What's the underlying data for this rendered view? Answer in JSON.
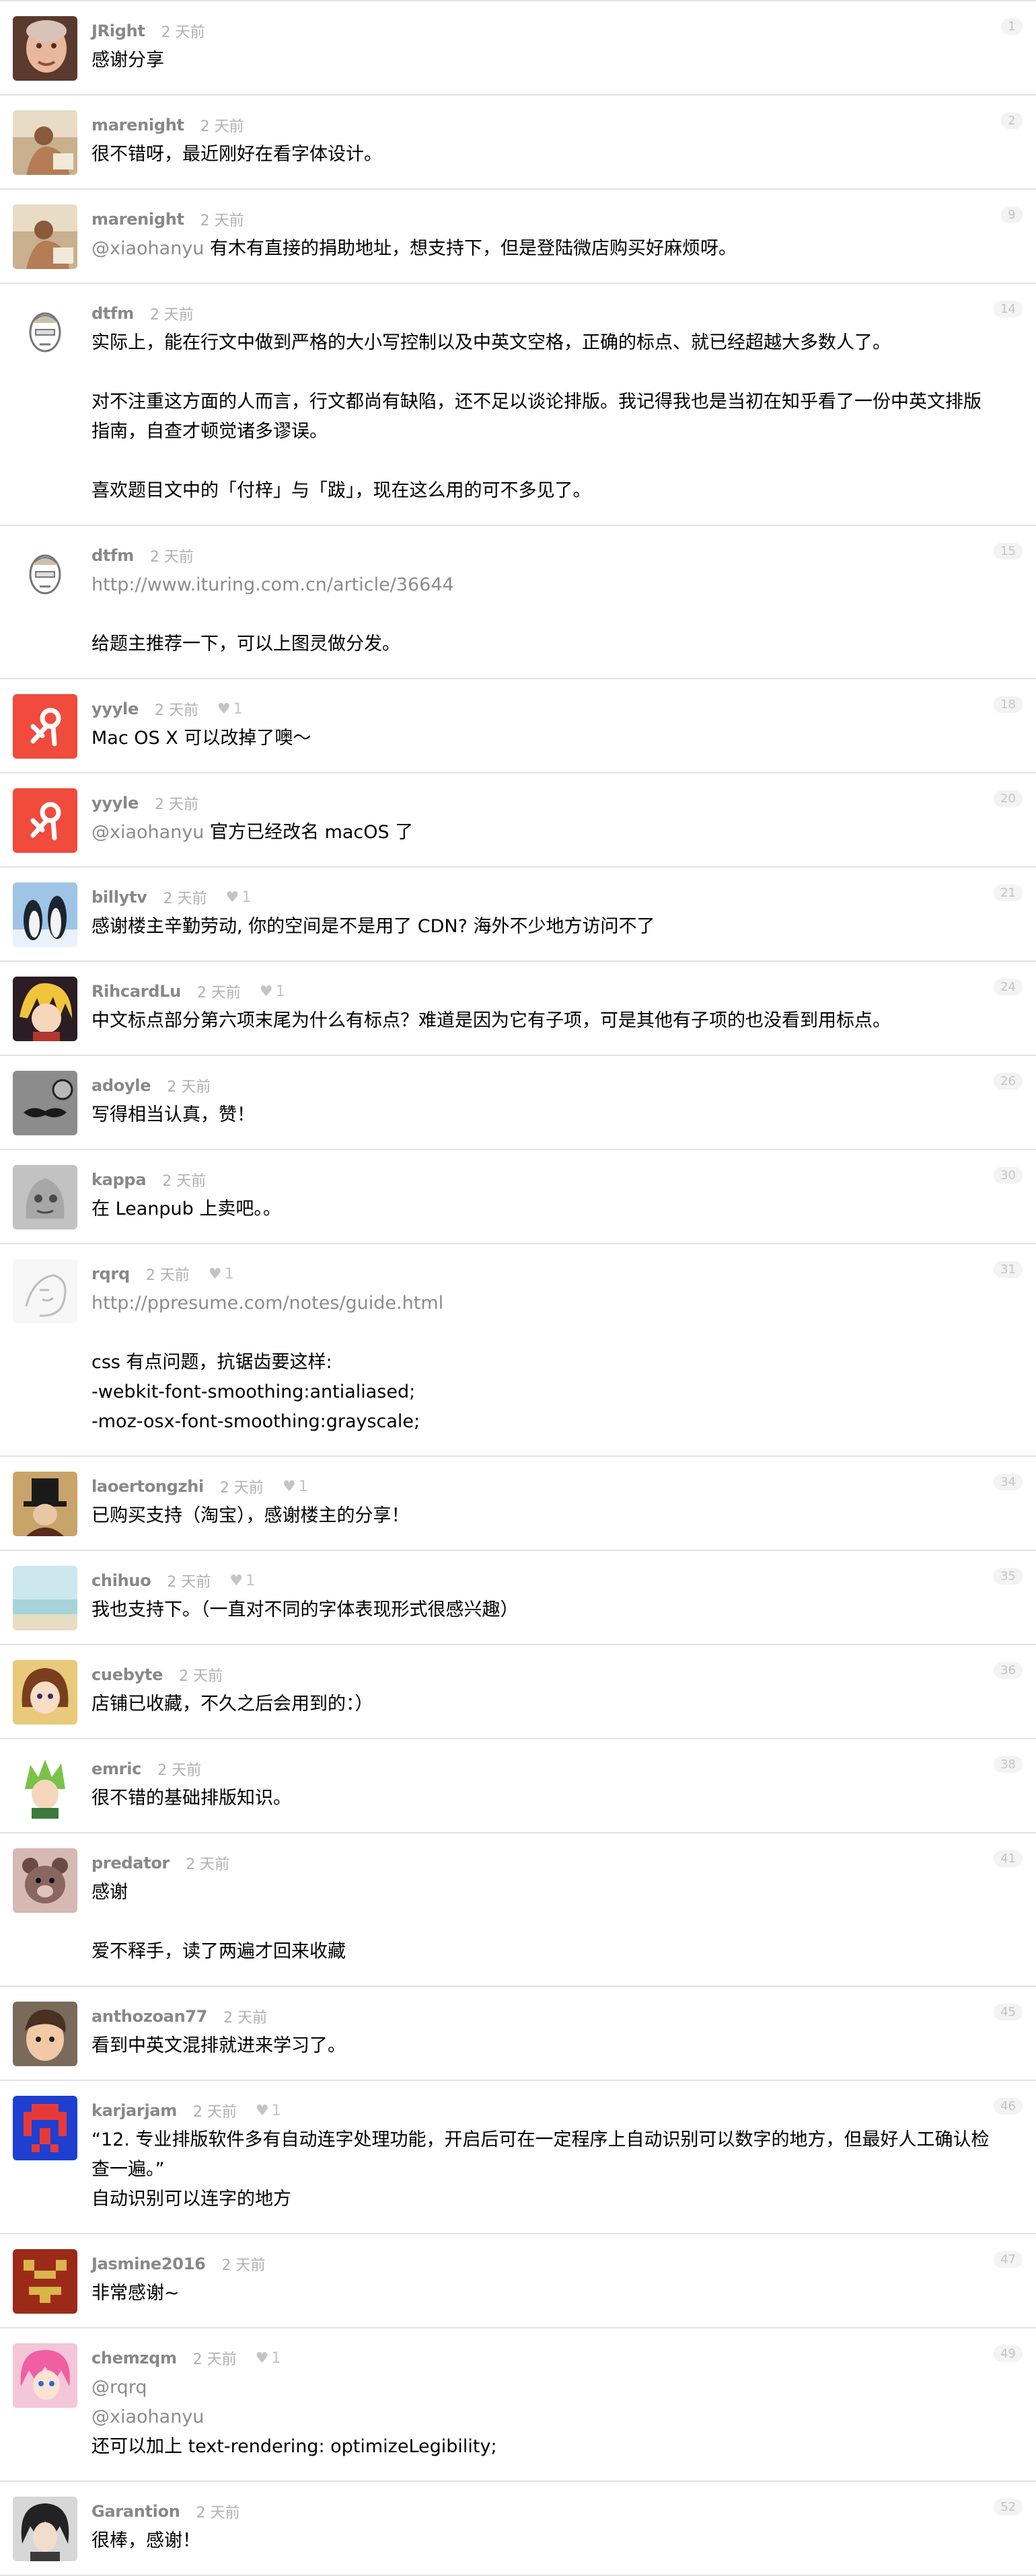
{
  "colors": {
    "author": "#888888",
    "time": "#b0b0b0",
    "link": "#8c8c8c",
    "divider": "#e2e2e2",
    "floor_bg": "#f3f3f3"
  },
  "replies": [
    {
      "author": "JRight",
      "ago": "2 天前",
      "floor": "1",
      "avatar": "face-man-icon",
      "lines": [
        {
          "parts": [
            {
              "text": "感谢分享"
            }
          ]
        }
      ]
    },
    {
      "author": "marenight",
      "ago": "2 天前",
      "floor": "2",
      "avatar": "photo-figure-icon",
      "lines": [
        {
          "parts": [
            {
              "text": "很不错呀，最近刚好在看字体设计。"
            }
          ]
        }
      ]
    },
    {
      "author": "marenight",
      "ago": "2 天前",
      "floor": "9",
      "avatar": "photo-figure-icon",
      "lines": [
        {
          "parts": [
            {
              "text": "@xiaohanyu",
              "link": true
            },
            {
              "text": " 有木有直接的捐助地址，想支持下，但是登陆微店购买好麻烦呀。"
            }
          ]
        }
      ]
    },
    {
      "author": "dtfm",
      "ago": "2 天前",
      "floor": "14",
      "avatar": "sketch-head-icon",
      "lines": [
        {
          "parts": [
            {
              "text": "实际上，能在行文中做到严格的大小写控制以及中英文空格，正确的标点、就已经超越大多数人了。"
            }
          ]
        },
        {
          "blank": true
        },
        {
          "parts": [
            {
              "text": "对不注重这方面的人而言，行文都尚有缺陷，还不足以谈论排版。我记得我也是当初在知乎看了一份中英文排版"
            }
          ]
        },
        {
          "parts": [
            {
              "text": "指南，自查才顿觉诸多谬误。"
            }
          ]
        },
        {
          "blank": true
        },
        {
          "parts": [
            {
              "text": "喜欢题目文中的「付梓」与「跋」，现在这么用的可不多见了。"
            }
          ]
        }
      ]
    },
    {
      "author": "dtfm",
      "ago": "2 天前",
      "floor": "15",
      "avatar": "sketch-head-icon",
      "lines": [
        {
          "parts": [
            {
              "text": "http://www.ituring.com.cn/article/36644",
              "link": true
            }
          ]
        },
        {
          "blank": true
        },
        {
          "parts": [
            {
              "text": "给题主推荐一下，可以上图灵做分发。"
            }
          ]
        }
      ]
    },
    {
      "author": "yyyle",
      "ago": "2 天前",
      "likes": "1",
      "floor": "18",
      "avatar": "red-tile-glyph-icon",
      "lines": [
        {
          "parts": [
            {
              "text": "Mac OS X 可以改掉了噢～"
            }
          ]
        }
      ]
    },
    {
      "author": "yyyle",
      "ago": "2 天前",
      "floor": "20",
      "avatar": "red-tile-glyph-icon",
      "lines": [
        {
          "parts": [
            {
              "text": "@xiaohanyu",
              "link": true
            },
            {
              "text": " 官方已经改名 macOS 了"
            }
          ]
        }
      ]
    },
    {
      "author": "billytv",
      "ago": "2 天前",
      "likes": "1",
      "floor": "21",
      "avatar": "penguins-icon",
      "lines": [
        {
          "parts": [
            {
              "text": "感谢楼主辛勤劳动, 你的空间是不是用了 CDN? 海外不少地方访问不了"
            }
          ]
        }
      ]
    },
    {
      "author": "RihcardLu",
      "ago": "2 天前",
      "likes": "1",
      "floor": "24",
      "avatar": "anime-blonde-icon",
      "lines": [
        {
          "parts": [
            {
              "text": "中文标点部分第六项末尾为什么有标点？难道是因为它有子项，可是其他有子项的也没看到用标点。"
            }
          ]
        }
      ]
    },
    {
      "author": "adoyle",
      "ago": "2 天前",
      "floor": "26",
      "avatar": "mustache-icon",
      "lines": [
        {
          "parts": [
            {
              "text": "写得相当认真，赞！"
            }
          ]
        }
      ]
    },
    {
      "author": "kappa",
      "ago": "2 天前",
      "floor": "30",
      "avatar": "gray-sketch-icon",
      "lines": [
        {
          "parts": [
            {
              "text": "在 Leanpub 上卖吧。。"
            }
          ]
        }
      ]
    },
    {
      "author": "rqrq",
      "ago": "2 天前",
      "likes": "1",
      "floor": "31",
      "avatar": "line-drawing-icon",
      "lines": [
        {
          "parts": [
            {
              "text": "http://ppresume.com/notes/guide.html",
              "link": true
            }
          ]
        },
        {
          "blank": true
        },
        {
          "parts": [
            {
              "text": "css 有点问题，抗锯齿要这样:"
            }
          ]
        },
        {
          "parts": [
            {
              "text": "-webkit-font-smoothing:antialiased;"
            }
          ]
        },
        {
          "parts": [
            {
              "text": "-moz-osx-font-smoothing:grayscale;"
            }
          ]
        }
      ]
    },
    {
      "author": "laoertongzhi",
      "ago": "2 天前",
      "likes": "1",
      "floor": "34",
      "avatar": "top-hat-icon",
      "lines": [
        {
          "parts": [
            {
              "text": "已购买支持（淘宝），感谢楼主的分享！"
            }
          ]
        }
      ]
    },
    {
      "author": "chihuo",
      "ago": "2 天前",
      "likes": "1",
      "floor": "35",
      "avatar": "sea-sky-icon",
      "lines": [
        {
          "parts": [
            {
              "text": "我也支持下。（一直对不同的字体表现形式很感兴趣）"
            }
          ]
        }
      ]
    },
    {
      "author": "cuebyte",
      "ago": "2 天前",
      "floor": "36",
      "avatar": "anime-girl-icon",
      "lines": [
        {
          "parts": [
            {
              "text": "店铺已收藏，不久之后会用到的：）"
            }
          ]
        }
      ]
    },
    {
      "author": "emric",
      "ago": "2 天前",
      "floor": "38",
      "avatar": "green-hair-icon",
      "lines": [
        {
          "parts": [
            {
              "text": "很不错的基础排版知识。"
            }
          ]
        }
      ]
    },
    {
      "author": "predator",
      "ago": "2 天前",
      "floor": "41",
      "avatar": "teddy-bear-icon",
      "lines": [
        {
          "parts": [
            {
              "text": "感谢"
            }
          ]
        },
        {
          "blank": true
        },
        {
          "parts": [
            {
              "text": "爱不释手，读了两遍才回来收藏"
            }
          ]
        }
      ]
    },
    {
      "author": "anthozoan77",
      "ago": "2 天前",
      "floor": "45",
      "avatar": "child-face-icon",
      "lines": [
        {
          "parts": [
            {
              "text": "看到中英文混排就进来学习了。"
            }
          ]
        }
      ]
    },
    {
      "author": "karjarjam",
      "ago": "2 天前",
      "likes": "1",
      "floor": "46",
      "avatar": "pixel-invader-icon",
      "lines": [
        {
          "parts": [
            {
              "text": "“12. 专业排版软件多有自动连字处理功能，开启后可在一定程序上自动识别可以数字的地方，但最好人工确认检"
            }
          ]
        },
        {
          "parts": [
            {
              "text": "查一遍。”"
            }
          ]
        },
        {
          "parts": [
            {
              "text": "自动识别可以连字的地方"
            }
          ]
        }
      ]
    },
    {
      "author": "Jasmine2016",
      "ago": "2 天前",
      "floor": "47",
      "avatar": "pixel-face-icon",
      "lines": [
        {
          "parts": [
            {
              "text": "非常感谢~"
            }
          ]
        }
      ]
    },
    {
      "author": "chemzqm",
      "ago": "2 天前",
      "likes": "1",
      "floor": "49",
      "avatar": "pink-hair-icon",
      "lines": [
        {
          "parts": [
            {
              "text": "@rqrq",
              "link": true
            }
          ]
        },
        {
          "parts": [
            {
              "text": "@xiaohanyu",
              "link": true
            }
          ]
        },
        {
          "parts": [
            {
              "text": "还可以加上 text-rendering: optimizeLegibility;"
            }
          ]
        }
      ]
    },
    {
      "author": "Garantion",
      "ago": "2 天前",
      "floor": "52",
      "avatar": "dark-hair-icon",
      "lines": [
        {
          "parts": [
            {
              "text": "很棒，感谢！"
            }
          ]
        }
      ]
    }
  ]
}
